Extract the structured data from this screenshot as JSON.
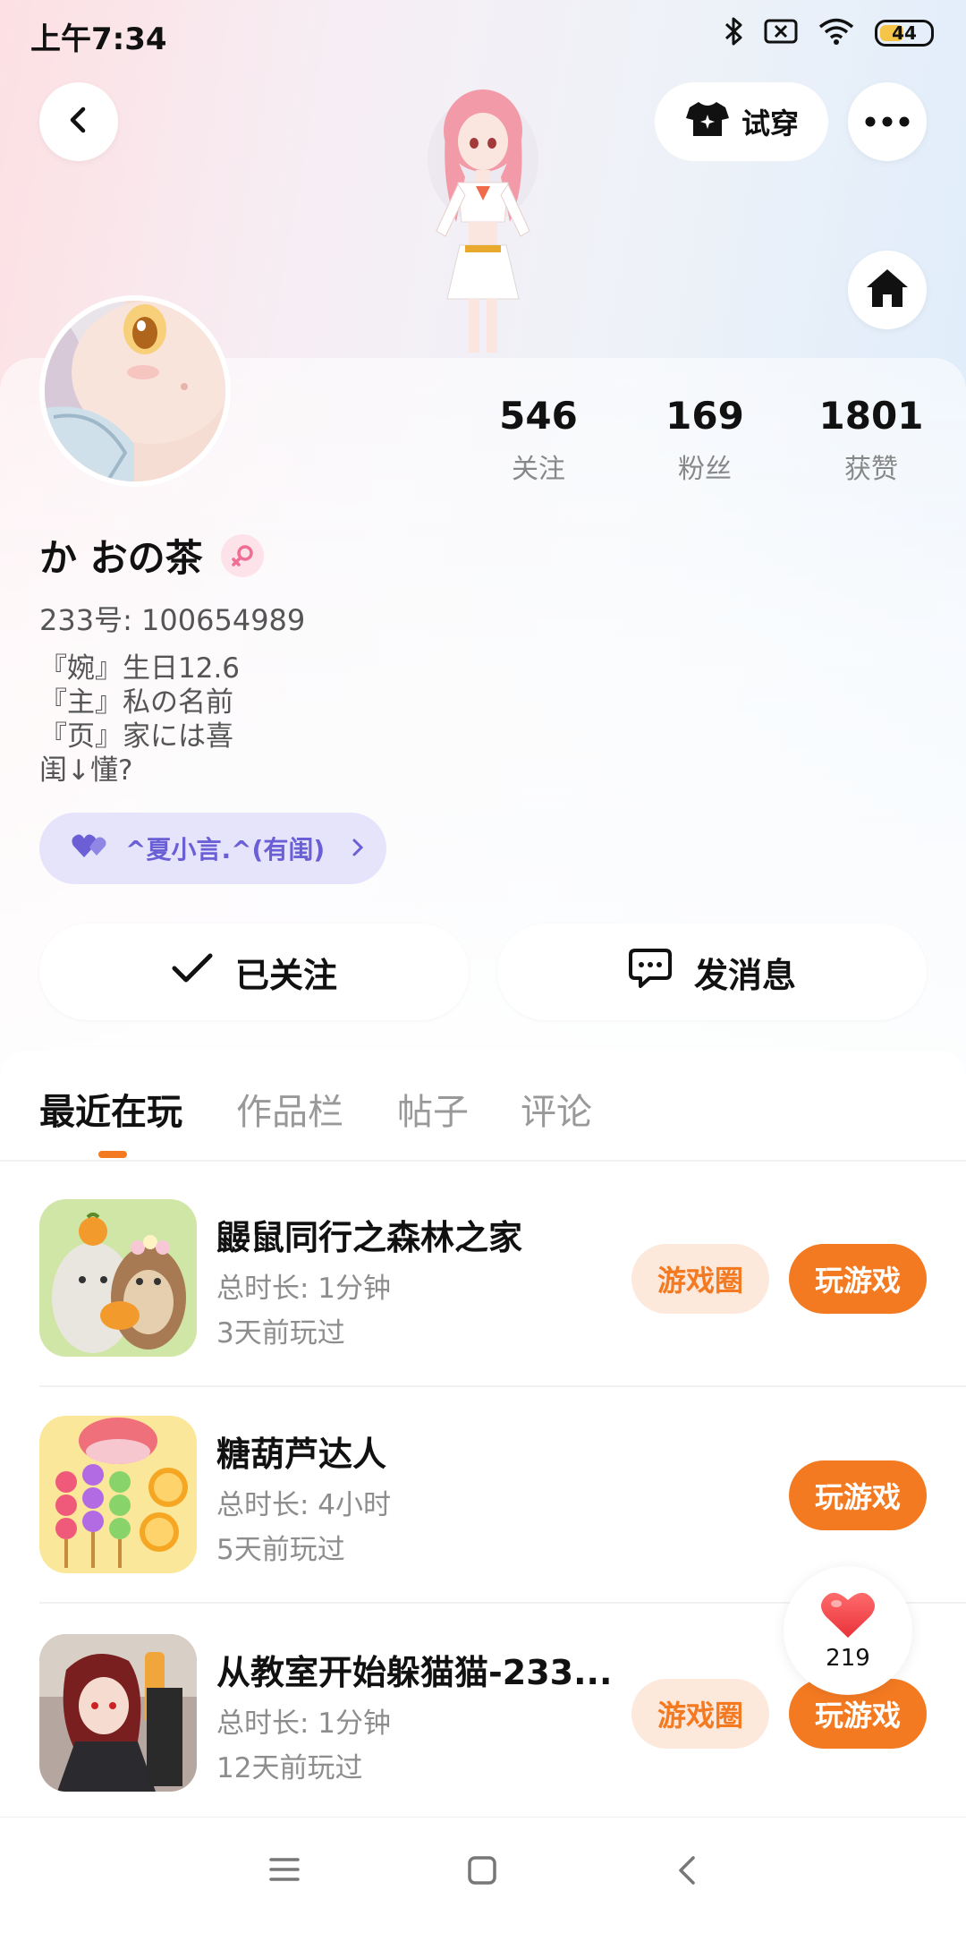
{
  "status_bar": {
    "time": "上午7:34",
    "battery": "44",
    "icons": [
      "bluetooth-icon",
      "no-sim-icon",
      "wifi-icon",
      "battery-icon"
    ]
  },
  "header": {
    "try_on_label": "试穿"
  },
  "profile": {
    "stats": [
      {
        "value": "546",
        "label": "关注"
      },
      {
        "value": "169",
        "label": "粉丝"
      },
      {
        "value": "1801",
        "label": "获赞"
      }
    ],
    "nickname": "か おの茶",
    "uid": "233号: 100654989",
    "bio": [
      "『婉』生日12.6",
      "『主』私の名前",
      "『页』家には喜",
      "闺↓懂?"
    ],
    "cp_label": "^夏小言.^(有闺)",
    "follow_label": "已关注",
    "message_label": "发消息"
  },
  "tabs": [
    "最近在玩",
    "作品栏",
    "帖子",
    "评论"
  ],
  "games": [
    {
      "title": "鼹鼠同行之森林之家",
      "duration": "总时长: 1分钟",
      "last_played": "3天前玩过",
      "circle_label": "游戏圈",
      "play_label": "玩游戏",
      "has_circle": true
    },
    {
      "title": "糖葫芦达人",
      "duration": "总时长: 4小时",
      "last_played": "5天前玩过",
      "circle_label": "",
      "play_label": "玩游戏",
      "has_circle": false
    },
    {
      "title": "从教室开始躲猫猫-233...",
      "duration": "总时长: 1分钟",
      "last_played": "12天前玩过",
      "circle_label": "游戏圈",
      "play_label": "玩游戏",
      "has_circle": true
    }
  ],
  "like_float": {
    "count": "219"
  },
  "colors": {
    "accent": "#f47a22",
    "accent_soft": "#fde8dc",
    "cp_purple": "#6b5fd6"
  }
}
